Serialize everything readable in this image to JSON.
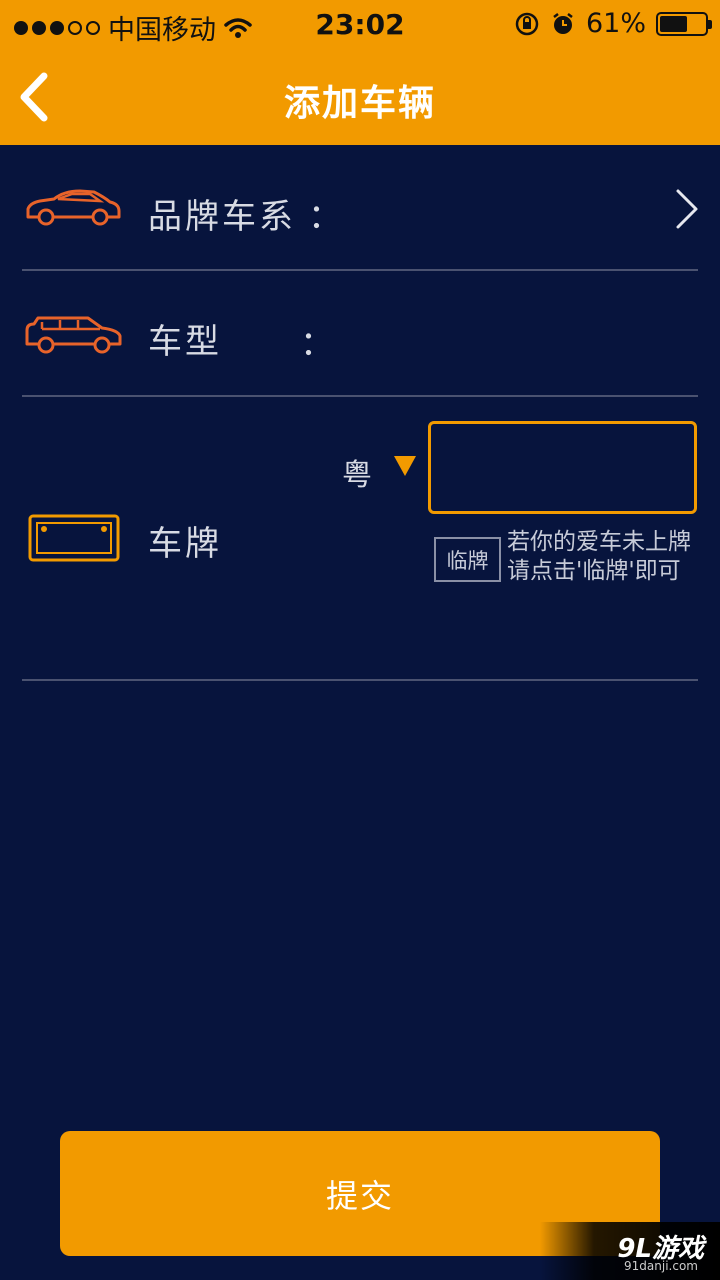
{
  "status_bar": {
    "carrier": "中国移动",
    "time": "23:02",
    "battery": "61%",
    "battery_level": 0.61,
    "icons": [
      "signal-dots",
      "wifi-icon",
      "rotation-lock-icon",
      "alarm-icon",
      "battery-icon"
    ]
  },
  "nav": {
    "title": "添加车辆",
    "back_icon": "chevron-left-icon"
  },
  "form": {
    "brand": {
      "label": "品牌车系",
      "colon": "：",
      "icon": "sedan-car-icon",
      "chevron": "chevron-right-icon"
    },
    "model": {
      "label": "车型",
      "colon": "：",
      "icon": "suv-car-icon"
    },
    "plate": {
      "label": "车牌",
      "icon": "license-plate-icon",
      "province": "粤",
      "input_value": "",
      "temp_button": "临牌",
      "hint": "若你的爱车未上牌请点击'临牌'即可"
    }
  },
  "submit": {
    "label": "提交"
  },
  "watermark": {
    "logo": "9L游戏",
    "url": "91danji.com"
  },
  "colors": {
    "accent": "#f29a00",
    "background": "#07143d",
    "divider": "#4a5270"
  }
}
